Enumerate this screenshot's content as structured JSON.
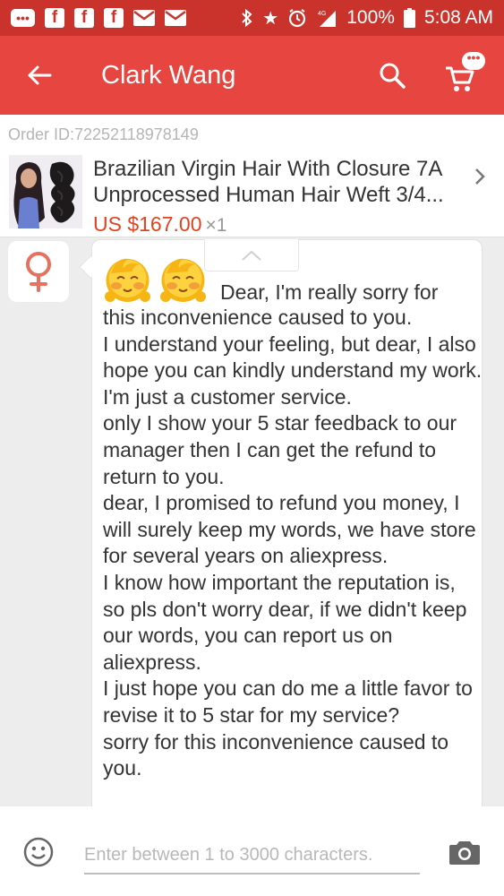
{
  "status_bar": {
    "battery": "100%",
    "time": "5:08 AM",
    "network": "4G"
  },
  "header": {
    "title": "Clark Wang",
    "icons": [
      "back-arrow-icon",
      "search-icon",
      "cart-icon"
    ],
    "cart_badge": "•••"
  },
  "order": {
    "order_id": "Order ID:72252118978149",
    "product_name": "Brazilian Virgin Hair With Closure 7A Unprocessed Human Hair Weft 3/4...",
    "price": "US $167.00",
    "quantity": "×1"
  },
  "chat": {
    "first_line": "Dear, I'm really sorry for",
    "message": "this inconvenience caused to you.\nI understand your feeling, but dear, I also hope you can kindly understand my work. I'm just a customer service.\nonly I show your 5 star feedback to our manager then I can get the refund to return to you.\ndear, I promised to refund you money, I will surely keep my words, we have store for several years on aliexpress.\nI know how important the reputation is, so pls don't worry dear, if we didn't keep our words, you can report us on aliexpress.\nI just hope you can do me a little favor to revise it to 5 star for my service?\nsorry for this inconvenience caused to you."
  },
  "input": {
    "placeholder": "Enter between 1 to 3000 characters.",
    "value": ""
  },
  "colors": {
    "status_bar": "#c9332b",
    "header": "#e64540",
    "price": "#e0431f",
    "avatar_symbol": "#e8705f"
  }
}
